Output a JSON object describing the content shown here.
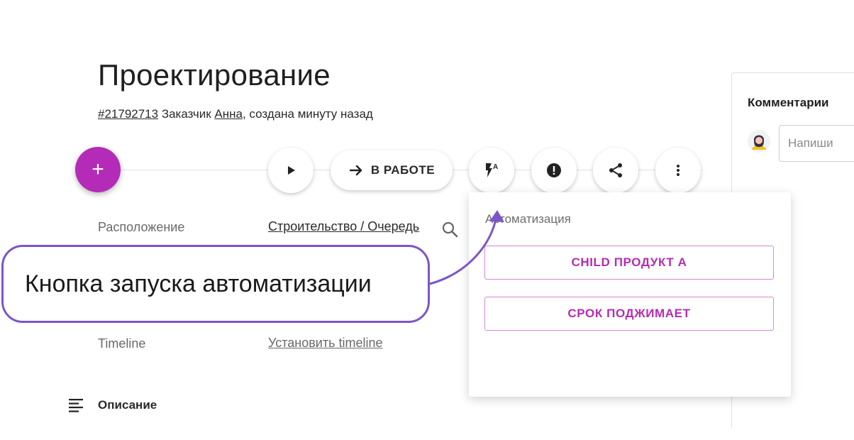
{
  "task": {
    "title": "Проектирование",
    "id": "#21792713",
    "customer_prefix": "Заказчик",
    "customer_name": "Анна",
    "created_text": ", создана минуту назад"
  },
  "toolbar": {
    "add_label": "+",
    "status_label": "В РАБОТЕ"
  },
  "fields": {
    "location_label": "Расположение",
    "location_value": "Строительство / Очередь",
    "timeline_label": "Timeline",
    "timeline_value": "Установить timeline"
  },
  "description": {
    "label": "Описание"
  },
  "automation_menu": {
    "title": "Автоматизация",
    "items": [
      "CHILD ПРОДУКТ А",
      "СРОК ПОДЖИМАЕТ"
    ]
  },
  "comments": {
    "title": "Комментарии",
    "placeholder": "Напиши"
  },
  "callout": {
    "text": "Кнопка запуска автоматизации"
  },
  "colors": {
    "accent": "#b42bb7",
    "callout_border": "#7b56c9",
    "outline_button": "#d489d4"
  }
}
